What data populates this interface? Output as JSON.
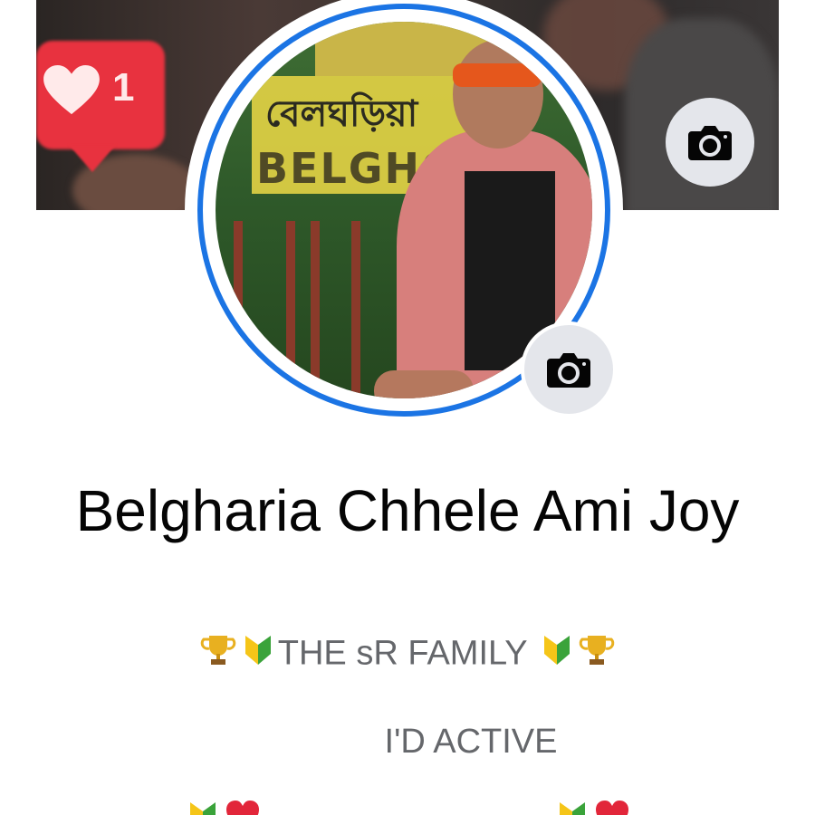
{
  "cover": {
    "like_count": "1"
  },
  "profile": {
    "name": "Belgharia Chhele Ami Joy",
    "photo_sign_bengali": "বেলঘড়িয়া",
    "photo_sign_english": "BELGHORIA"
  },
  "bio": {
    "line1_text": "THE sR FAMILY",
    "line2_text": "I'D ACTIVE"
  },
  "icons": {
    "cover_camera": "camera-icon",
    "profile_camera": "camera-icon",
    "trophy": "trophy-emoji",
    "beginner": "japanese-beginner-emoji",
    "heart": "red-heart-emoji"
  },
  "colors": {
    "ring_blue": "#1b74e4",
    "like_red": "#e8323f",
    "text_primary": "#050505",
    "text_secondary": "#65676b",
    "button_bg": "#e4e6eb"
  }
}
